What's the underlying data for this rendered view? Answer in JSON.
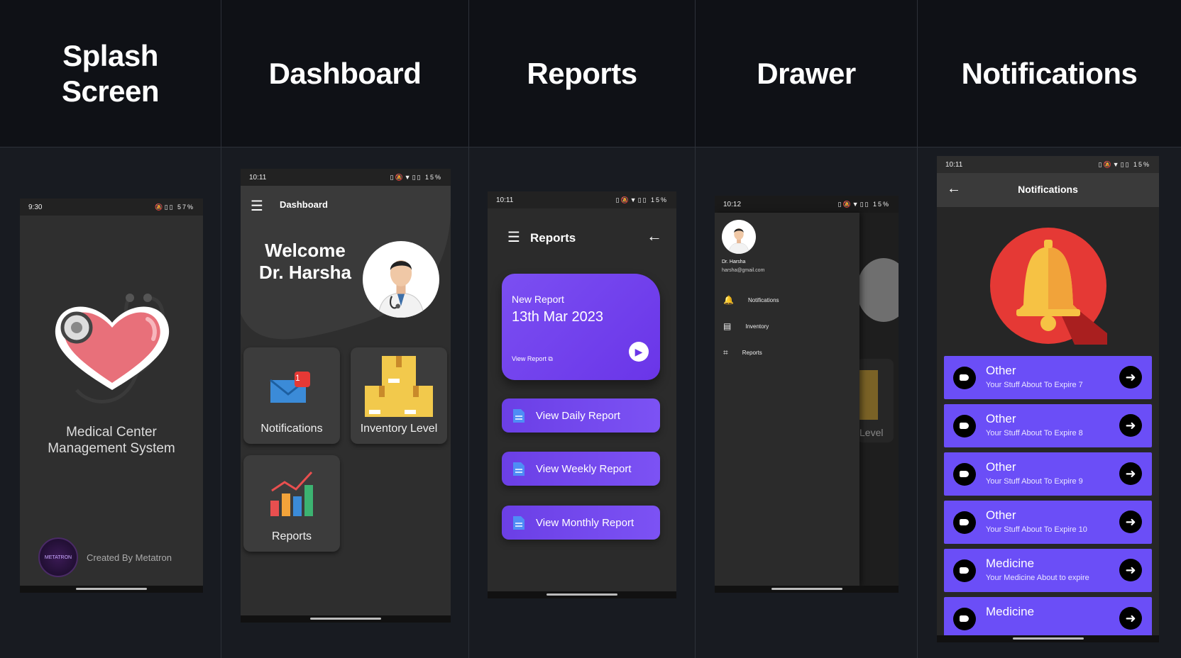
{
  "columns": {
    "splash": {
      "header": "Splash\nScreen"
    },
    "dashboard": {
      "header": "Dashboard"
    },
    "reports": {
      "header": "Reports"
    },
    "drawer": {
      "header": "Drawer"
    },
    "notifications": {
      "header": "Notifications"
    }
  },
  "splash_screen": {
    "status_time": "9:30",
    "status_battery": "57%",
    "app_title": "Medical Center\nManagement System",
    "created_by": "Created By Metatron",
    "logo_text": "METATRON",
    "heart_color": "#e8707a"
  },
  "dashboard_screen": {
    "status_time": "10:11",
    "status_battery": "15%",
    "appbar_title": "Dashboard",
    "welcome_line1": "Welcome",
    "welcome_line2": "Dr. Harsha",
    "tiles": [
      {
        "label": "Notifications",
        "badge": "1",
        "icon": "envelope-icon"
      },
      {
        "label": "Inventory Level",
        "icon": "boxes-icon"
      },
      {
        "label": "Reports",
        "icon": "bar-chart-icon"
      }
    ]
  },
  "reports_screen": {
    "status_time": "10:11",
    "status_battery": "15%",
    "appbar_title": "Reports",
    "card": {
      "label": "New Report",
      "date": "13th Mar 2023",
      "link": "View Report"
    },
    "buttons": [
      "View Daily Report",
      "View Weekly Report",
      "View Monthly Report"
    ],
    "accent": "#7346ee"
  },
  "drawer_screen": {
    "status_time": "10:12",
    "status_battery": "15%",
    "user_name": "Dr. Harsha",
    "user_email": "harsha@gmail.com",
    "items": [
      "Notifications",
      "Inventory",
      "Reports"
    ],
    "behind_label": "Level"
  },
  "notifications_screen": {
    "status_time": "10:11",
    "status_battery": "15%",
    "appbar_title": "Notifications",
    "items": [
      {
        "title": "Other",
        "subtitle": "Your Stuff About To Expire 7"
      },
      {
        "title": "Other",
        "subtitle": "Your Stuff About To Expire 8"
      },
      {
        "title": "Other",
        "subtitle": "Your Stuff About To Expire 9"
      },
      {
        "title": "Other",
        "subtitle": "Your Stuff About To Expire 10"
      },
      {
        "title": "Medicine",
        "subtitle": "Your Medicine About to expire"
      },
      {
        "title": "Medicine",
        "subtitle": ""
      }
    ],
    "card_color": "#6b4ef7",
    "bell_bg_color": "#e53935"
  }
}
